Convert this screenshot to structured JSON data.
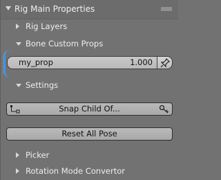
{
  "panel": {
    "title": "Rig Main Properties"
  },
  "sections": {
    "rig_layers": "Rig Layers",
    "bone_custom_props": "Bone Custom Props",
    "settings": "Settings",
    "picker": "Picker",
    "rotation_mode": "Rotation Mode Convertor"
  },
  "property": {
    "name": "my_prop",
    "value": "1.000"
  },
  "buttons": {
    "snap": "Snap Child Of...",
    "reset": "Reset All Pose"
  },
  "icons": {
    "panel_toggle": "triangle-down-icon",
    "drag_handle": "grip-icon",
    "pin": "pin-icon",
    "snap_left": "constraint-icon",
    "snap_right": "key-icon"
  }
}
